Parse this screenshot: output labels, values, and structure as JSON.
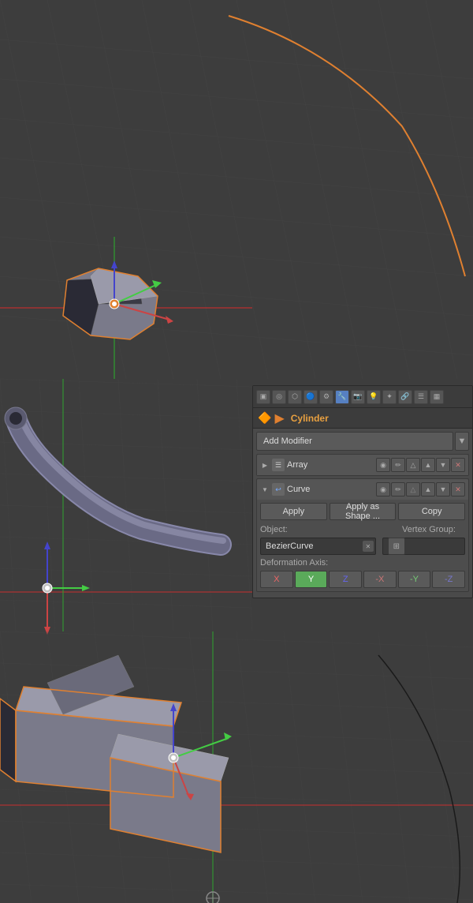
{
  "viewport": {
    "background_color": "#3d3d3d",
    "grid_color": "#484848"
  },
  "panel": {
    "title": "Cylinder",
    "object_icon": "🔶",
    "add_modifier_label": "Add Modifier",
    "modifiers": [
      {
        "id": "array",
        "name": "Array",
        "expanded": false,
        "icon": "☰"
      },
      {
        "id": "curve",
        "name": "Curve",
        "expanded": true,
        "icon": "〜"
      }
    ],
    "curve_modifier": {
      "apply_label": "Apply",
      "apply_as_shape_label": "Apply as Shape ...",
      "copy_label": "Copy",
      "object_label": "Object:",
      "object_value": "BezierCurve",
      "vertex_group_label": "Vertex Group:",
      "deformation_axis_label": "Deformation Axis:",
      "axes": [
        "X",
        "Y",
        "Z",
        "-X",
        "-Y",
        "-Z"
      ],
      "active_axis": "Y"
    }
  },
  "toolbar_icons": [
    "▣",
    "◉",
    "⬡",
    "🌐",
    "⚙",
    "🔧",
    "📷",
    "💡",
    "✦",
    "🔗",
    "☰",
    "▦",
    "▣"
  ]
}
